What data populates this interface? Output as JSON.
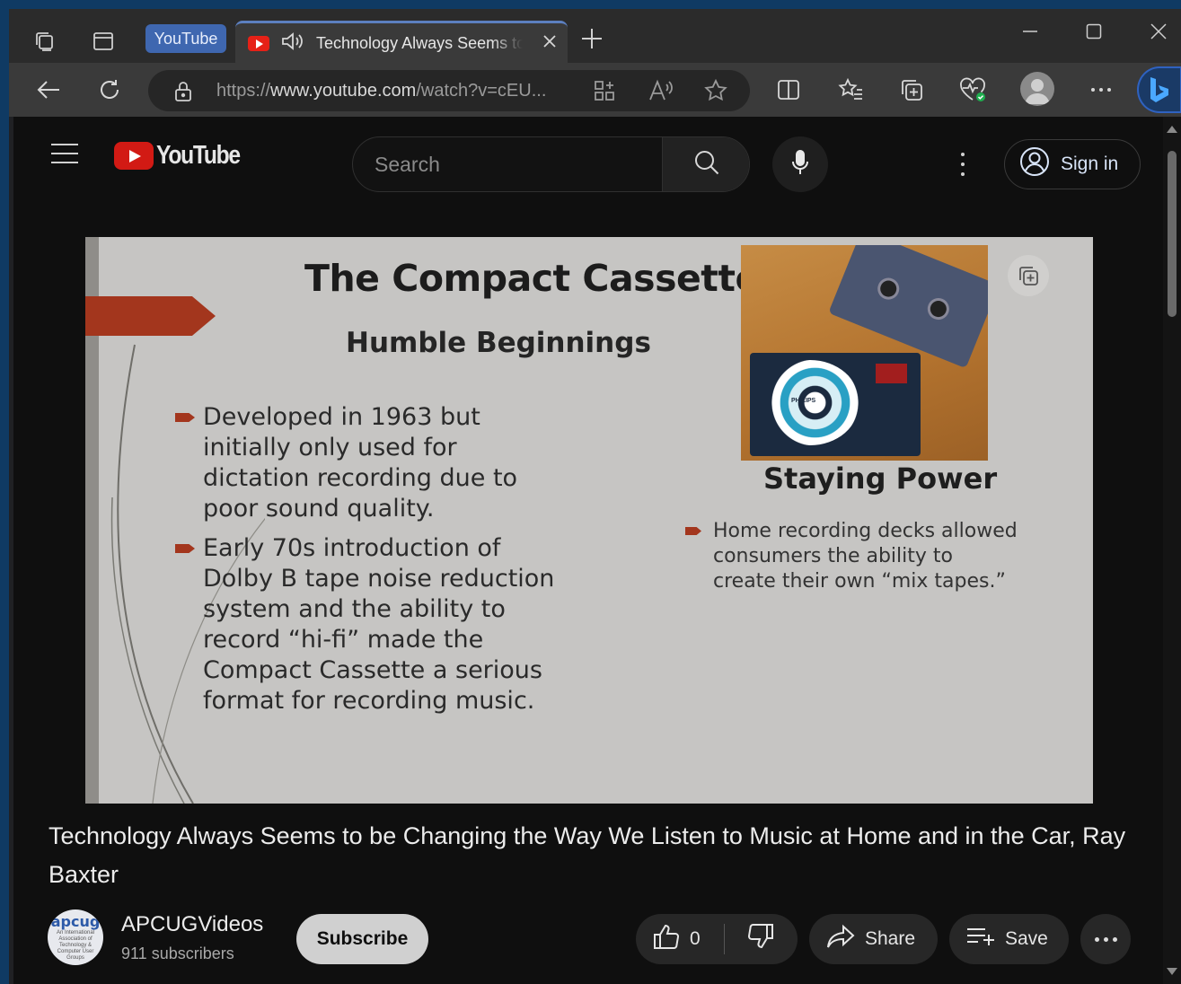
{
  "browser": {
    "tab_group_label": "YouTube",
    "tab_title": "Technology Always Seems to be Changing the Way We Listen to Music at Home and in the Car, Ray Baxter",
    "url_prefix": "https://",
    "url_host": "www.youtube.com",
    "url_path": "/watch?v=cEU...",
    "icons": [
      "workspaces-icon",
      "tab-actions-icon",
      "speaker-icon",
      "close-icon",
      "new-tab-icon",
      "minimize-icon",
      "maximize-icon",
      "window-close-icon",
      "back-icon",
      "refresh-icon",
      "lock-icon",
      "app-available-icon",
      "read-aloud-icon",
      "favorite-star-icon",
      "split-screen-icon",
      "favorites-icon",
      "collections-icon",
      "browser-essentials-icon",
      "profile-icon",
      "more-icon",
      "bing-icon"
    ]
  },
  "youtube": {
    "logo_text": "YouTube",
    "search_placeholder": "Search",
    "signin_label": "Sign in"
  },
  "slide": {
    "title": "The Compact Cassette",
    "subtitle": "Humble Beginnings",
    "bullets": [
      "Developed in 1963 but initially only used for dictation recording due to poor sound quality.",
      "Early 70s introduction of Dolby B tape noise reduction system and the ability to record “hi-fi” made the Compact Cassette a serious format for recording music."
    ],
    "right_heading": "Staying Power",
    "right_bullet": "Home recording decks allowed consumers the ability to create their own “mix tapes.”",
    "photo_label": "PHILIPS"
  },
  "video": {
    "title": "Technology Always Seems to be Changing the Way We Listen to Music at Home and in the Car, Ray Baxter",
    "channel_name": "APCUGVideos",
    "subscribers": "911 subscribers",
    "channel_avatar_text": "apcug",
    "channel_avatar_subtext": "An International Association of Technology & Computer User Groups",
    "subscribe_label": "Subscribe",
    "like_count": "0",
    "share_label": "Share",
    "save_label": "Save"
  },
  "colors": {
    "accent_blue": "#3f67b0",
    "youtube_red": "#d21a14",
    "slide_arrow": "#a3361d"
  }
}
